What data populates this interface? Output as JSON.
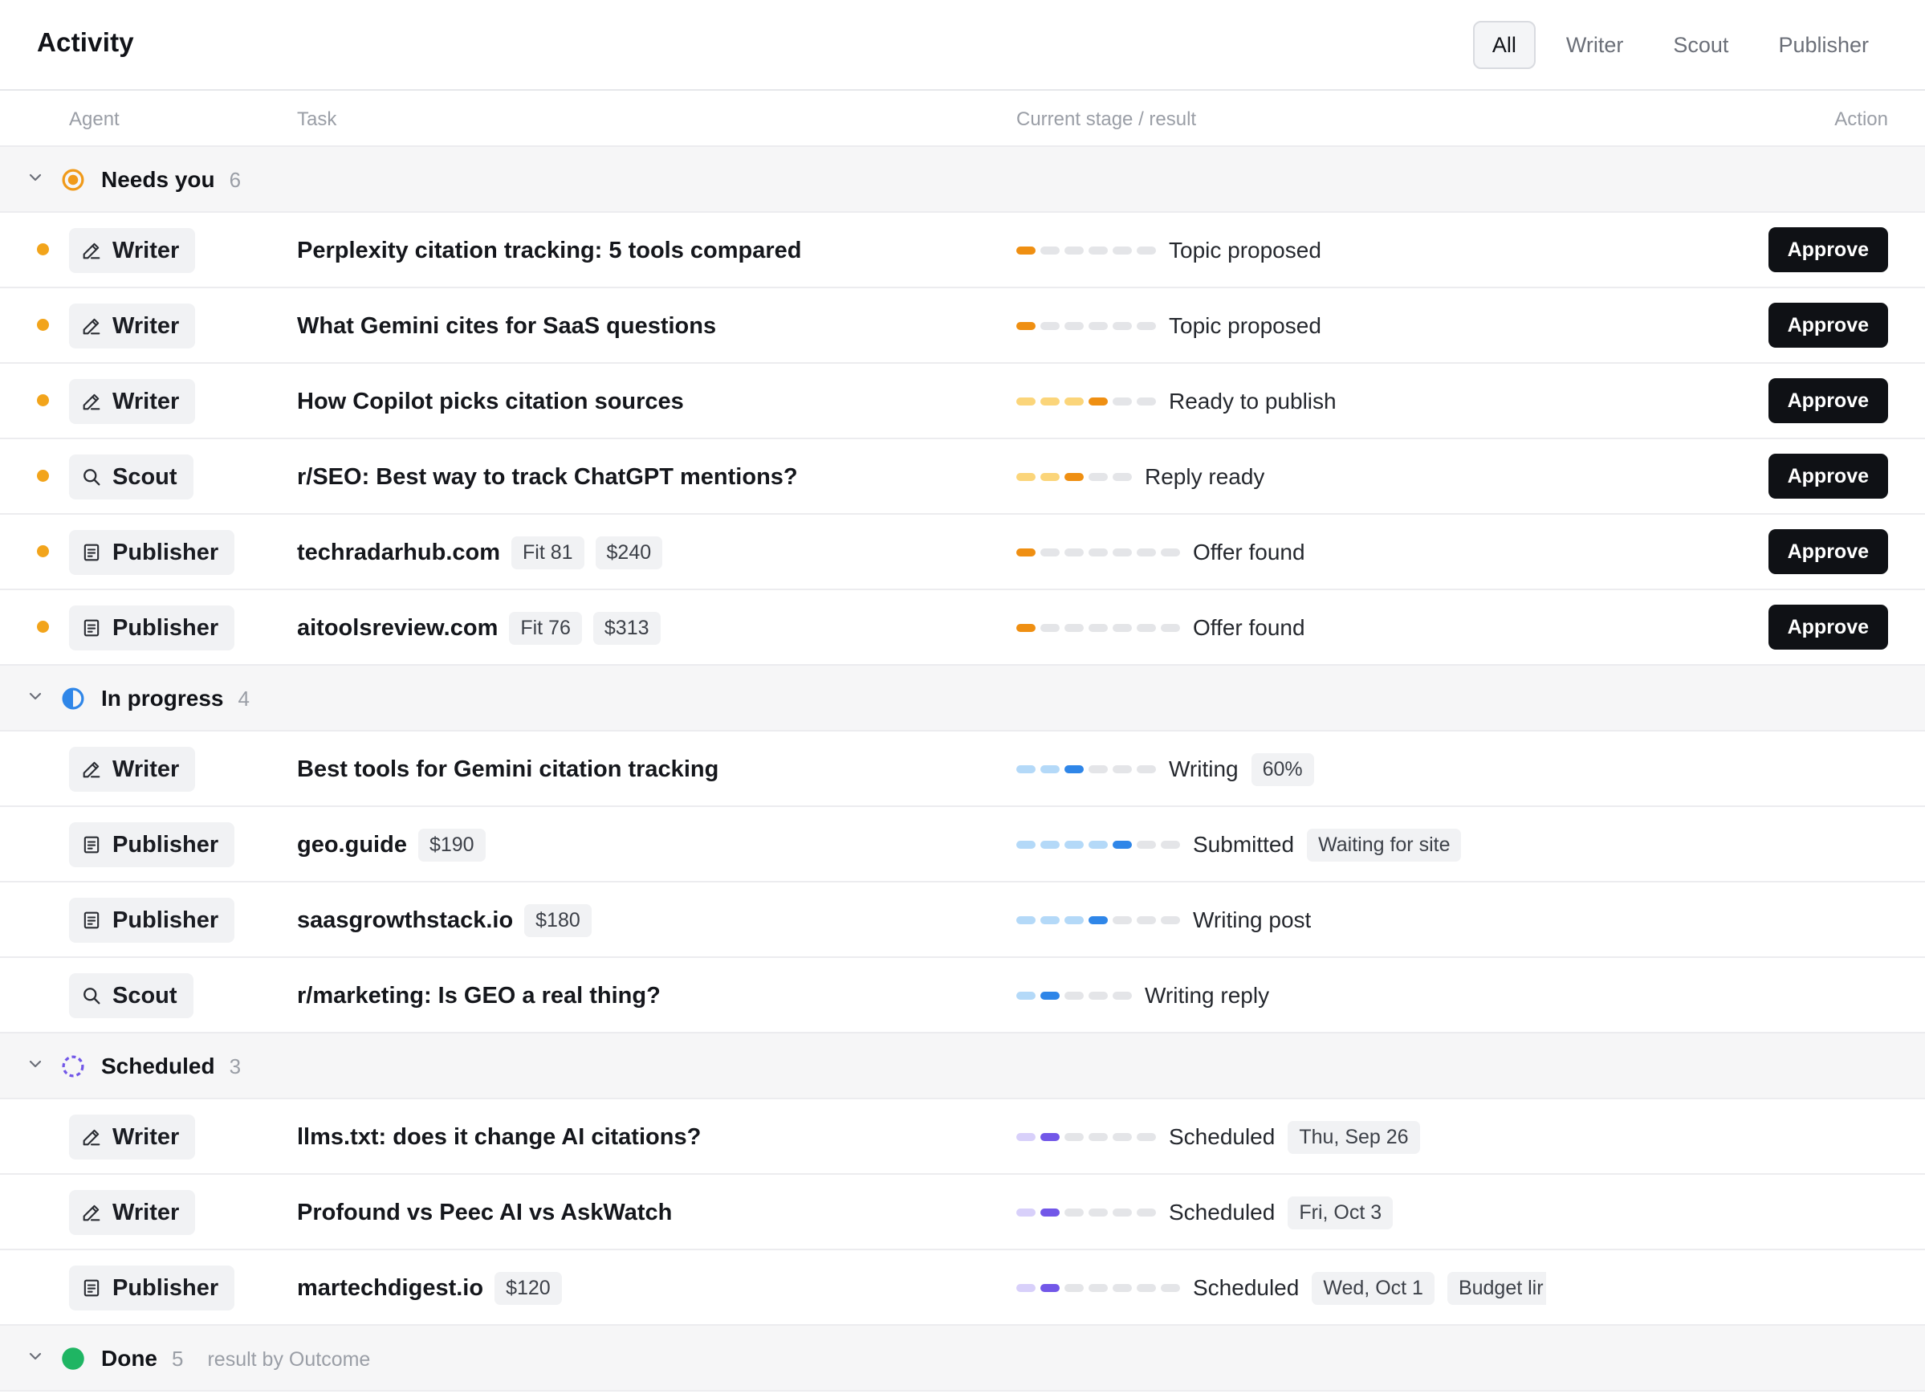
{
  "header": {
    "title": "Activity",
    "filters": [
      "All",
      "Writer",
      "Scout",
      "Publisher"
    ],
    "active_filter": "All"
  },
  "columns": {
    "agent": "Agent",
    "task": "Task",
    "stage": "Current stage / result",
    "action": "Action"
  },
  "colors": {
    "needs_dot": "#f2a41b",
    "orange_active": "#ef8f12",
    "orange_done": "#fbd57a",
    "blue_active": "#2f86e8",
    "blue_done": "#b4d9f8",
    "purple_active": "#7257e8",
    "purple_done": "#d8d0fa",
    "pending": "#e4e5e8",
    "done_green": "#1fb563"
  },
  "groups": [
    {
      "label": "Needs you",
      "count": "6",
      "note": "",
      "icon": "needs-you-icon",
      "tone": "orange",
      "rows": [
        {
          "agent": "Writer",
          "icon": "pencil-icon",
          "task": "Perplexity citation tracking: 5 tools compared",
          "chips": [],
          "stages": 6,
          "completed": 0,
          "stage": "Topic proposed",
          "badges": [],
          "action": "Approve",
          "attention": true
        },
        {
          "agent": "Writer",
          "icon": "pencil-icon",
          "task": "What Gemini cites for SaaS questions",
          "chips": [],
          "stages": 6,
          "completed": 0,
          "stage": "Topic proposed",
          "badges": [],
          "action": "Approve",
          "attention": true
        },
        {
          "agent": "Writer",
          "icon": "pencil-icon",
          "task": "How Copilot picks citation sources",
          "chips": [],
          "stages": 6,
          "completed": 3,
          "stage": "Ready to publish",
          "badges": [],
          "action": "Approve",
          "attention": true
        },
        {
          "agent": "Scout",
          "icon": "search-icon",
          "task": "r/SEO: Best way to track ChatGPT mentions?",
          "chips": [],
          "stages": 5,
          "completed": 2,
          "stage": "Reply ready",
          "badges": [],
          "action": "Approve",
          "attention": true
        },
        {
          "agent": "Publisher",
          "icon": "document-icon",
          "task": "techradarhub.com",
          "chips": [
            "Fit 81",
            "$240"
          ],
          "stages": 7,
          "completed": 0,
          "stage": "Offer found",
          "badges": [],
          "action": "Approve",
          "attention": true
        },
        {
          "agent": "Publisher",
          "icon": "document-icon",
          "task": "aitoolsreview.com",
          "chips": [
            "Fit 76",
            "$313"
          ],
          "stages": 7,
          "completed": 0,
          "stage": "Offer found",
          "badges": [],
          "action": "Approve",
          "attention": true
        }
      ]
    },
    {
      "label": "In progress",
      "count": "4",
      "note": "",
      "icon": "in-progress-icon",
      "tone": "blue",
      "rows": [
        {
          "agent": "Writer",
          "icon": "pencil-icon",
          "task": "Best tools for Gemini citation tracking",
          "chips": [],
          "stages": 6,
          "completed": 2,
          "stage": "Writing",
          "badges": [
            "60%"
          ],
          "action": "",
          "attention": false
        },
        {
          "agent": "Publisher",
          "icon": "document-icon",
          "task": "geo.guide",
          "chips": [
            "$190"
          ],
          "stages": 7,
          "completed": 4,
          "stage": "Submitted",
          "badges": [
            "Waiting for site"
          ],
          "action": "",
          "attention": false
        },
        {
          "agent": "Publisher",
          "icon": "document-icon",
          "task": "saasgrowthstack.io",
          "chips": [
            "$180"
          ],
          "stages": 7,
          "completed": 3,
          "stage": "Writing post",
          "badges": [],
          "action": "",
          "attention": false
        },
        {
          "agent": "Scout",
          "icon": "search-icon",
          "task": "r/marketing: Is GEO a real thing?",
          "chips": [],
          "stages": 5,
          "completed": 1,
          "stage": "Writing reply",
          "badges": [],
          "action": "",
          "attention": false
        }
      ]
    },
    {
      "label": "Scheduled",
      "count": "3",
      "note": "",
      "icon": "scheduled-icon",
      "tone": "purple",
      "rows": [
        {
          "agent": "Writer",
          "icon": "pencil-icon",
          "task": "llms.txt: does it change AI citations?",
          "chips": [],
          "stages": 6,
          "completed": 1,
          "stage": "Scheduled",
          "badges": [
            "Thu, Sep 26"
          ],
          "action": "",
          "attention": false
        },
        {
          "agent": "Writer",
          "icon": "pencil-icon",
          "task": "Profound vs Peec AI vs AskWatch",
          "chips": [],
          "stages": 6,
          "completed": 1,
          "stage": "Scheduled",
          "badges": [
            "Fri, Oct 3"
          ],
          "action": "",
          "attention": false
        },
        {
          "agent": "Publisher",
          "icon": "document-icon",
          "task": "martechdigest.io",
          "chips": [
            "$120"
          ],
          "stages": 7,
          "completed": 1,
          "stage": "Scheduled",
          "badges": [
            "Wed, Oct 1",
            "Budget lir"
          ],
          "action": "",
          "attention": false
        }
      ]
    },
    {
      "label": "Done",
      "count": "5",
      "note": "result by Outcome",
      "icon": "done-icon",
      "tone": "green",
      "rows": []
    }
  ]
}
